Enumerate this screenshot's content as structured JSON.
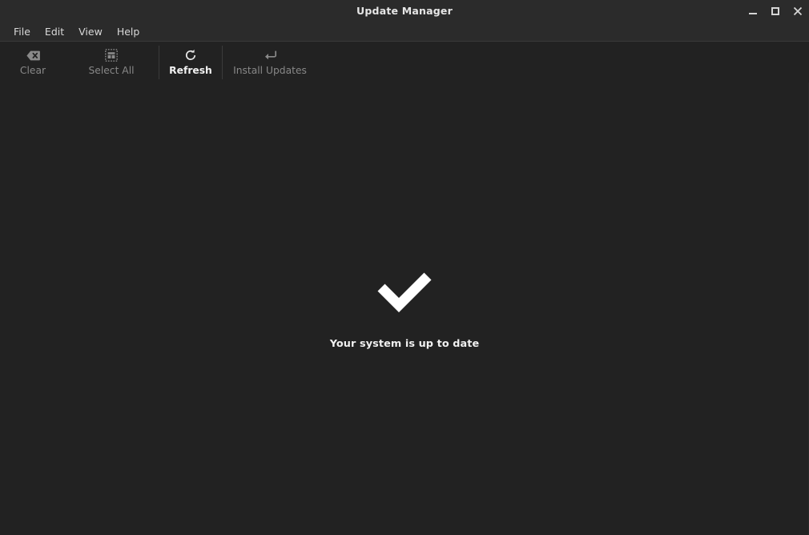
{
  "window": {
    "title": "Update Manager",
    "controls": [
      {
        "name": "minimize",
        "icon": "minimize-icon",
        "label": "Minimize"
      },
      {
        "name": "maximize",
        "icon": "maximize-icon",
        "label": "Maximize"
      },
      {
        "name": "close",
        "icon": "close-icon",
        "label": "Close"
      }
    ]
  },
  "menubar": {
    "items": [
      {
        "label": "File"
      },
      {
        "label": "Edit"
      },
      {
        "label": "View"
      },
      {
        "label": "Help"
      }
    ]
  },
  "toolbar": {
    "buttons": [
      {
        "label": "Clear",
        "icon": "backspace-clear-icon",
        "enabled": false
      },
      {
        "label": "Select All",
        "icon": "select-all-icon",
        "enabled": false
      },
      {
        "label": "Refresh",
        "icon": "refresh-icon",
        "enabled": true
      },
      {
        "label": "Install Updates",
        "icon": "install-updates-return-icon",
        "enabled": false
      }
    ]
  },
  "main": {
    "status_icon": "checkmark-icon",
    "status_message": "Your system is up to date"
  },
  "colors": {
    "titlebar_bg": "#2b2b2b",
    "content_bg": "#222222",
    "enabled_text": "#f2f2f2",
    "disabled_text": "#888888",
    "accent_check": "#ffffff"
  }
}
